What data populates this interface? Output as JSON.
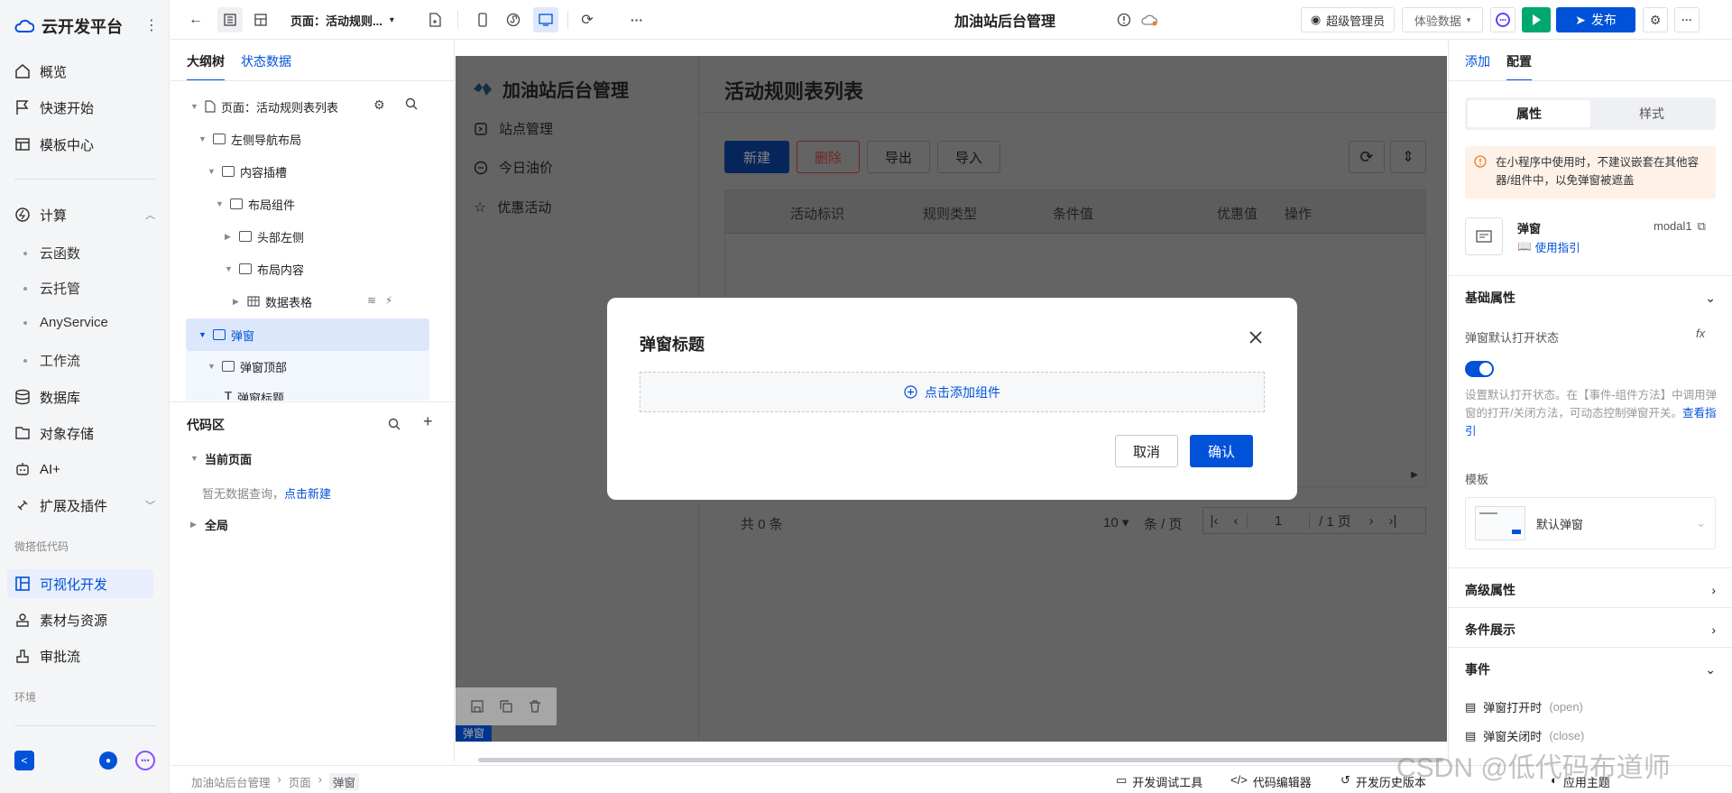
{
  "leftnav": {
    "brand": "云开发平台",
    "items": [
      {
        "label": "概览",
        "icon": "home-icon"
      },
      {
        "label": "快速开始",
        "icon": "flag-icon"
      },
      {
        "label": "模板中心",
        "icon": "template-icon"
      }
    ],
    "compute": {
      "label": "计算",
      "children": [
        "云函数",
        "云托管",
        "AnyService",
        "工作流"
      ]
    },
    "items2": [
      {
        "label": "数据库",
        "icon": "database-icon"
      },
      {
        "label": "对象存储",
        "icon": "storage-icon"
      },
      {
        "label": "AI+",
        "icon": "robot-icon"
      },
      {
        "label": "扩展及插件",
        "icon": "plugin-icon"
      }
    ],
    "group_lowcode": "微搭低代码",
    "lowcode_items": [
      {
        "label": "可视化开发",
        "icon": "layout-icon",
        "active": true
      },
      {
        "label": "素材与资源",
        "icon": "assets-icon"
      },
      {
        "label": "审批流",
        "icon": "approval-icon"
      }
    ],
    "group_env": "环境"
  },
  "toolbar": {
    "page_selector": "页面：活动规则...",
    "app_title": "加油站后台管理",
    "user": "超级管理员",
    "env": "体验数据",
    "publish": "发布"
  },
  "outline": {
    "tabs": [
      "大纲树",
      "状态数据"
    ],
    "nodes": [
      {
        "label": "页面：活动规则表列表"
      },
      {
        "label": "左侧导航布局"
      },
      {
        "label": "内容插槽"
      },
      {
        "label": "布局组件"
      },
      {
        "label": "头部左侧"
      },
      {
        "label": "布局内容"
      },
      {
        "label": "数据表格"
      },
      {
        "label": "弹窗"
      },
      {
        "label": "弹窗顶部"
      },
      {
        "label": "弹窗标题"
      }
    ]
  },
  "codearea": {
    "title": "代码区",
    "current_page": "当前页面",
    "empty": "暂无数据查询，",
    "create": "点击新建",
    "global": "全局"
  },
  "app": {
    "title": "加油站后台管理",
    "menu": [
      "站点管理",
      "今日油价",
      "优惠活动"
    ],
    "page_title": "活动规则表列表",
    "buttons": {
      "new": "新建",
      "delete": "删除",
      "export": "导出",
      "import": "导入"
    },
    "columns": [
      "活动标识",
      "规则类型",
      "条件值",
      "优惠值",
      "操作"
    ],
    "total": "共 0 条",
    "page_size": "10",
    "per_page": "条 / 页",
    "page_current": "1",
    "page_total": "/ 1 页"
  },
  "modal": {
    "title": "弹窗标题",
    "add_component": "点击添加组件",
    "cancel": "取消",
    "confirm": "确认"
  },
  "canvas_label": "弹窗",
  "right": {
    "tabs": [
      "添加",
      "配置"
    ],
    "seg": [
      "属性",
      "样式"
    ],
    "warning": "在小程序中使用时，不建议嵌套在其他容器/组件中，以免弹窗被遮盖",
    "component_name": "弹窗",
    "component_id": "modal1",
    "guide": "使用指引",
    "basic": "基础属性",
    "default_open": "弹窗默认打开状态",
    "desc": "设置默认打开状态。在【事件-组件方法】中调用弹窗的打开/关闭方法，可动态控制弹窗开关。",
    "see_guide": "查看指引",
    "template_label": "模板",
    "template_value": "默认弹窗",
    "advanced": "高级属性",
    "condition": "条件展示",
    "events": "事件",
    "event_open": "弹窗打开时",
    "event_open_code": "(open)",
    "event_close": "弹窗关闭时",
    "event_close_code": "(close)"
  },
  "bottom": {
    "crumbs": [
      "加油站后台管理",
      "页面",
      "弹窗"
    ],
    "debug": "开发调试工具",
    "code_editor": "代码编辑器",
    "history": "开发历史版本",
    "theme": "应用主题"
  },
  "watermark": "CSDN @低代码布道师",
  "colors": {
    "primary": "#0052d9",
    "publish": "#0052d9",
    "green": "#00a870",
    "danger": "#e34d59"
  }
}
